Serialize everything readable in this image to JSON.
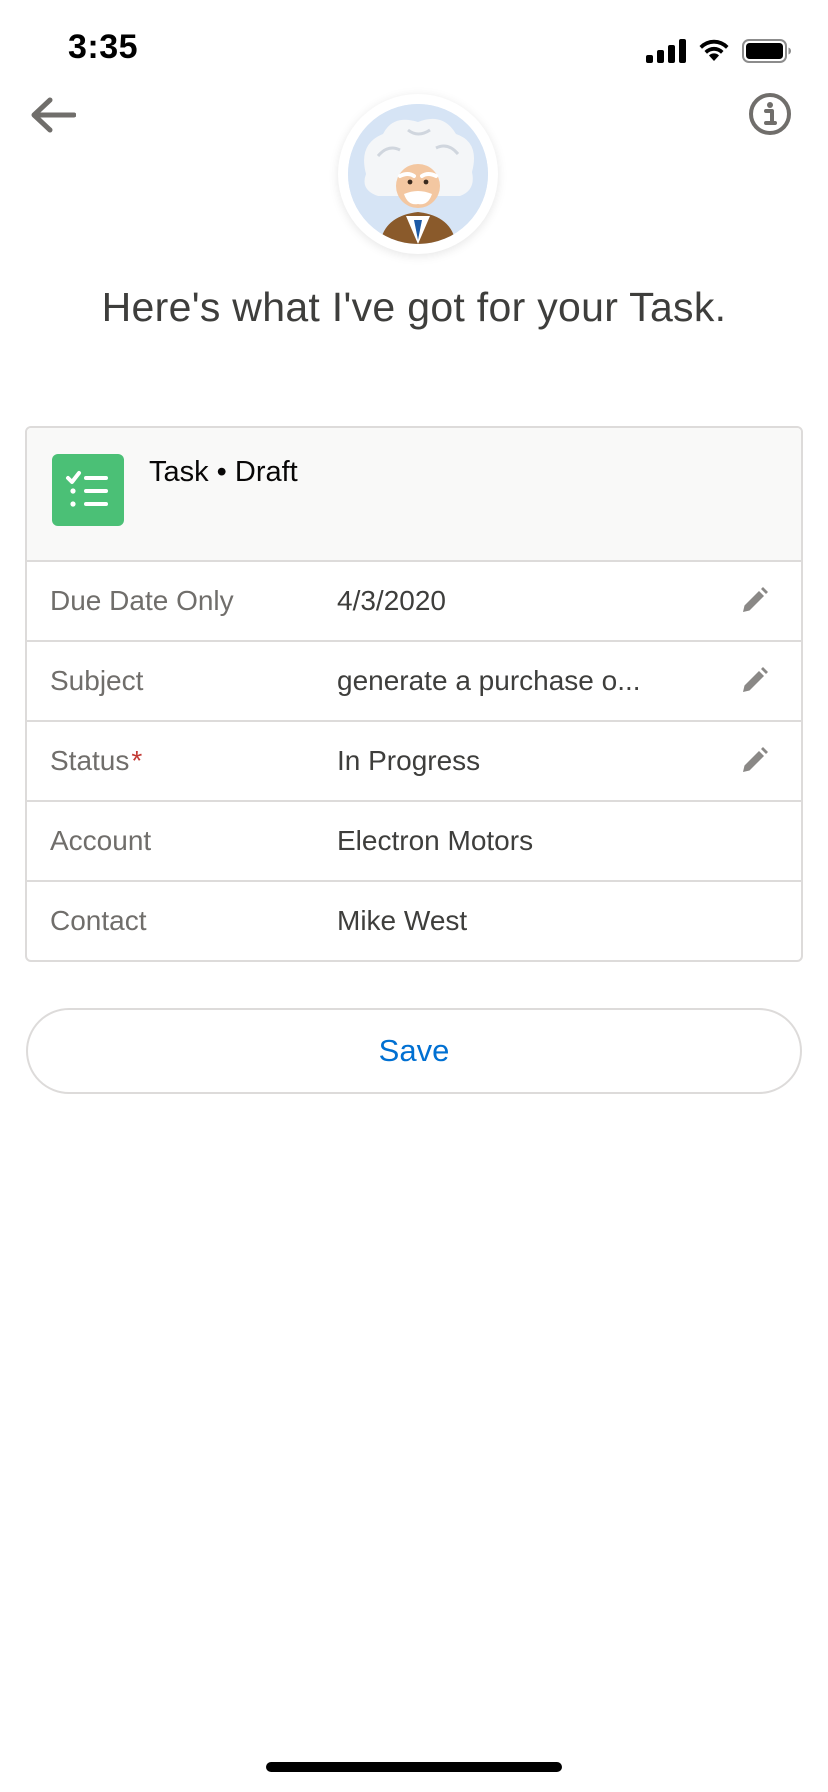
{
  "status_bar": {
    "time": "3:35"
  },
  "nav": {
    "back_icon": "arrow-left-icon",
    "info_icon": "info-icon"
  },
  "headline": "Here's what I've got for your Task.",
  "card": {
    "icon": "task-checklist-icon",
    "icon_color": "#4bc076",
    "title": "Task • Draft",
    "fields": [
      {
        "label": "Due Date Only",
        "value": "4/3/2020",
        "editable": true,
        "required": false
      },
      {
        "label": "Subject",
        "value": "generate a purchase o...",
        "editable": true,
        "required": false
      },
      {
        "label": "Status",
        "value": "In Progress",
        "editable": true,
        "required": true
      },
      {
        "label": "Account",
        "value": "Electron Motors",
        "editable": false,
        "required": false
      },
      {
        "label": "Contact",
        "value": "Mike West",
        "editable": false,
        "required": false
      }
    ]
  },
  "save_label": "Save",
  "colors": {
    "accent": "#0070d2",
    "required": "#c23934",
    "border": "#dddbda"
  }
}
